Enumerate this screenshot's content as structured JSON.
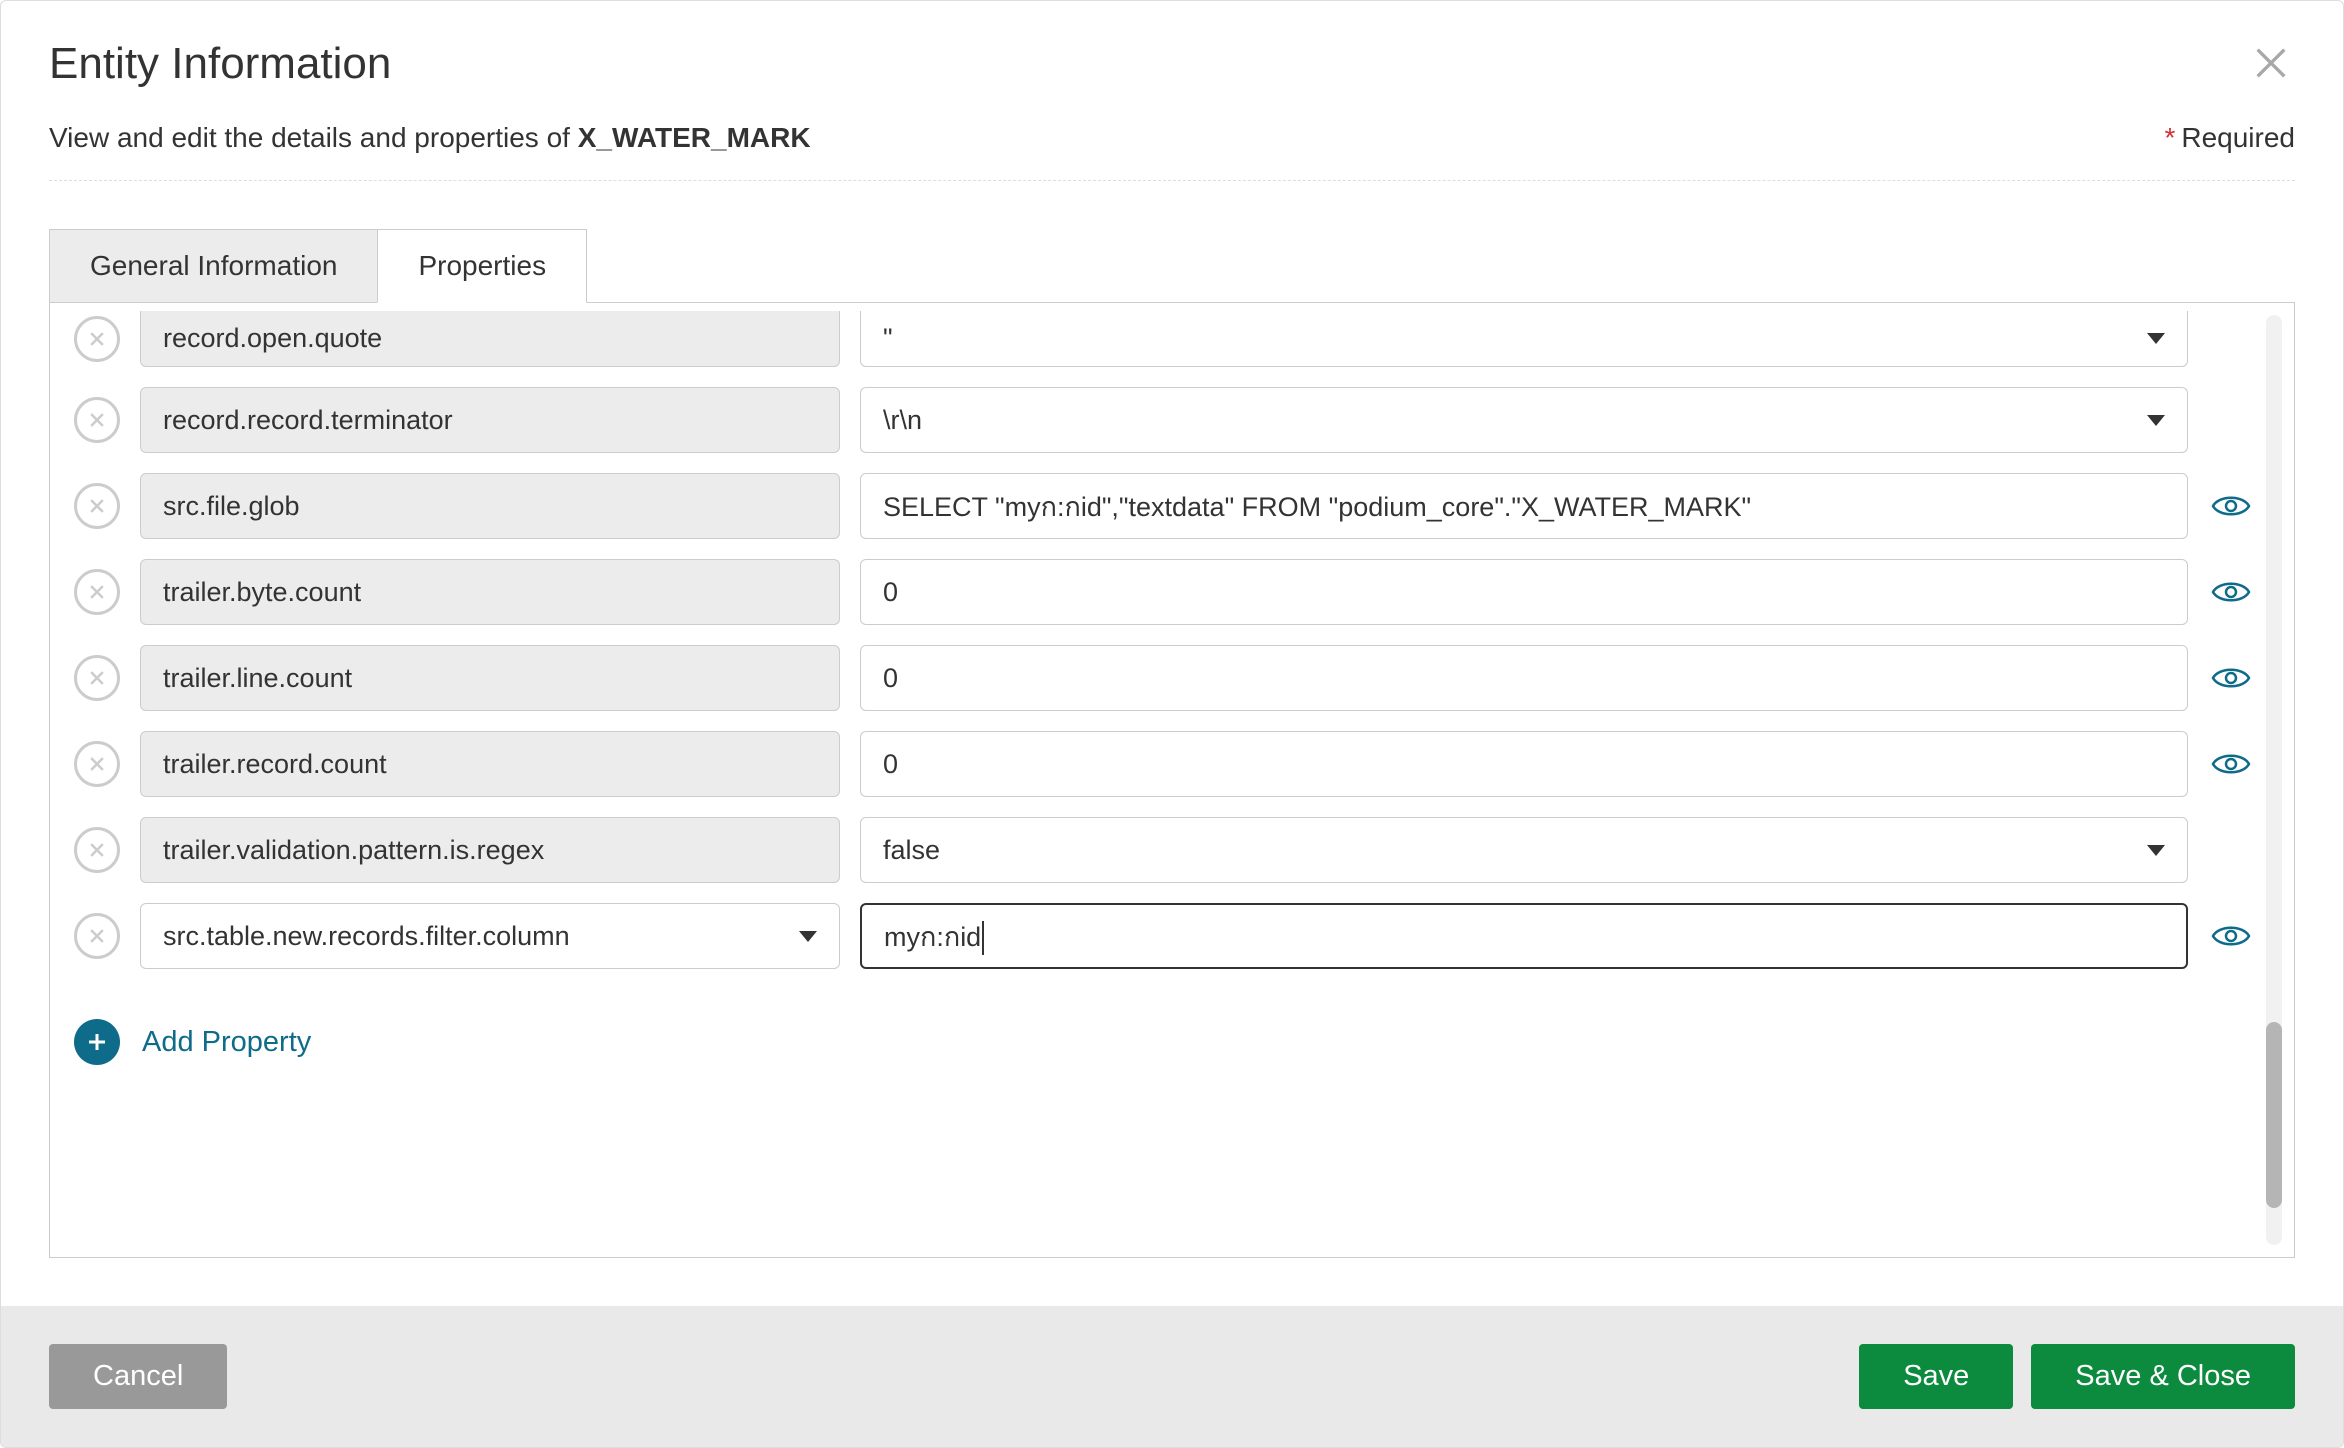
{
  "header": {
    "title": "Entity Information",
    "subtitle_prefix": "View and edit the details and properties of ",
    "entity_name": "X_WATER_MARK",
    "required_label": "Required"
  },
  "tabs": {
    "general": "General Information",
    "properties": "Properties"
  },
  "properties": [
    {
      "name": "record.open.quote",
      "value": "\"",
      "type": "select",
      "editable": false
    },
    {
      "name": "record.record.terminator",
      "value": "\\r\\n",
      "type": "select",
      "editable": false
    },
    {
      "name": "src.file.glob",
      "value": "SELECT \"myก:กid\",\"textdata\" FROM \"podium_core\".\"X_WATER_MARK\"",
      "type": "text",
      "editable": false
    },
    {
      "name": "trailer.byte.count",
      "value": "0",
      "type": "text",
      "editable": false
    },
    {
      "name": "trailer.line.count",
      "value": "0",
      "type": "text",
      "editable": false
    },
    {
      "name": "trailer.record.count",
      "value": "0",
      "type": "text",
      "editable": false
    },
    {
      "name": "trailer.validation.pattern.is.regex",
      "value": "false",
      "type": "select",
      "editable": false
    },
    {
      "name": "src.table.new.records.filter.column",
      "value": "myก:กid",
      "type": "text",
      "editable": true,
      "focused": true
    }
  ],
  "add_property_label": "Add Property",
  "footer": {
    "cancel": "Cancel",
    "save": "Save",
    "save_close": "Save & Close"
  },
  "scrollbar": {
    "thumb_top_pct": 76,
    "thumb_height_pct": 20
  }
}
